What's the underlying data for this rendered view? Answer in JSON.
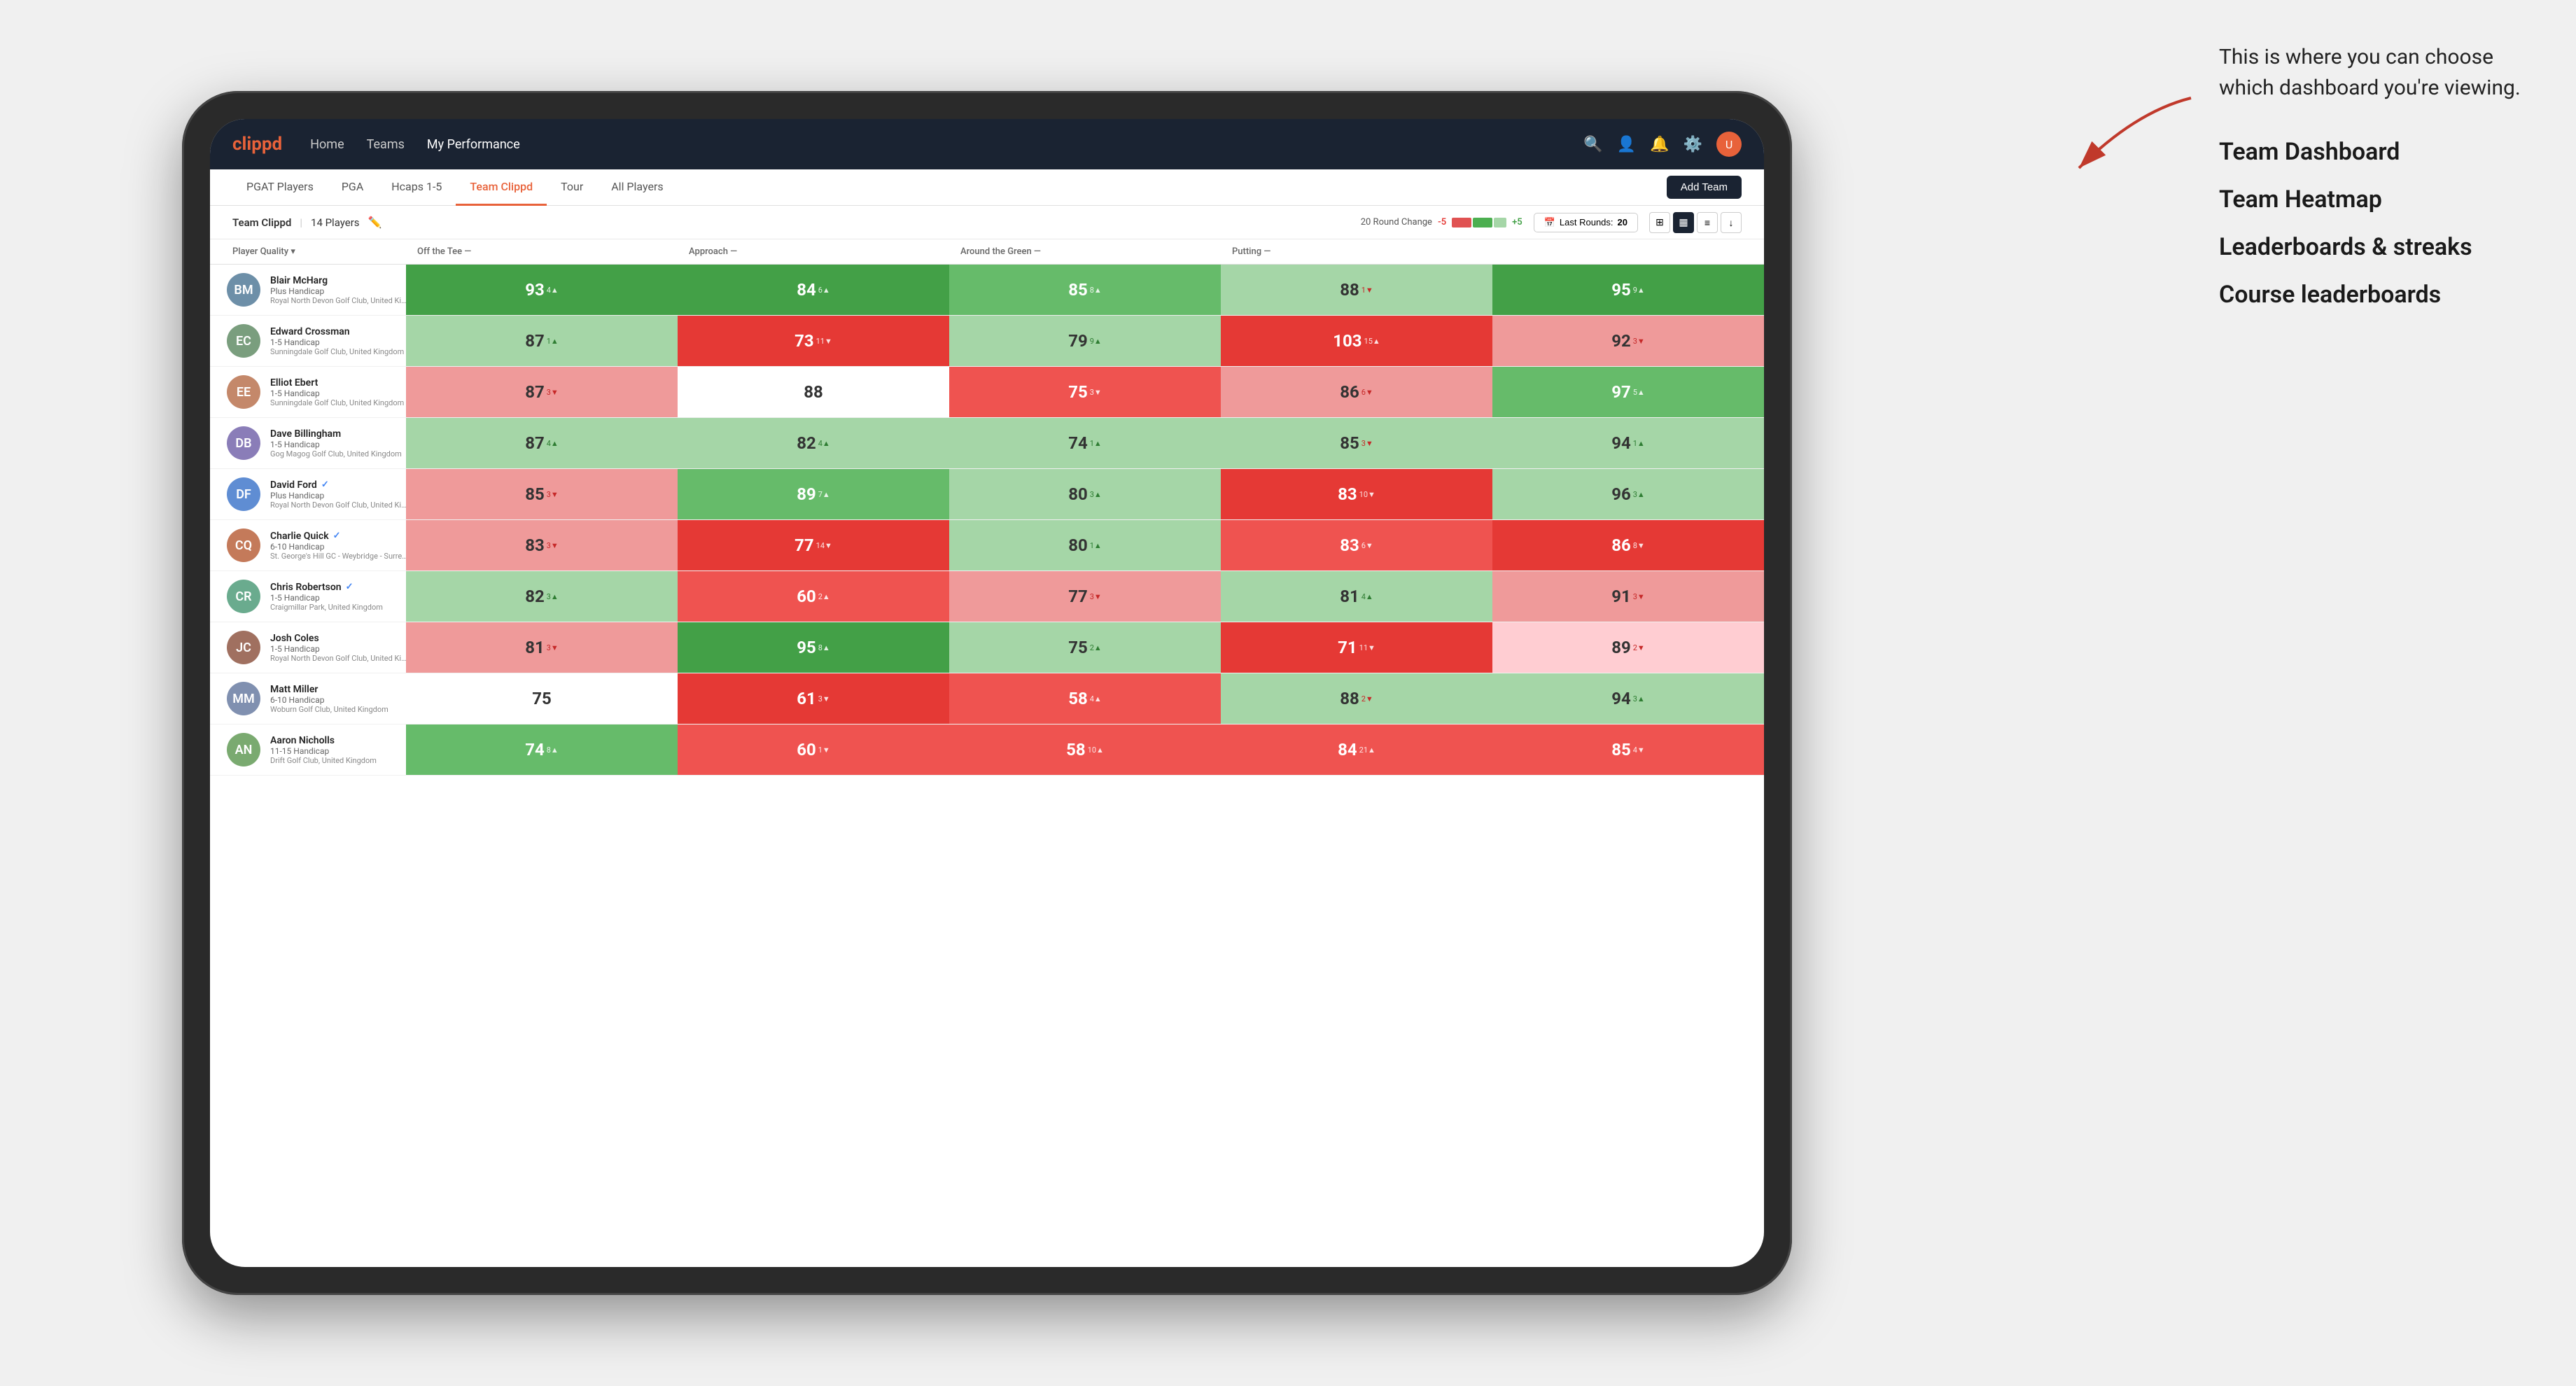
{
  "annotation": {
    "callout": "This is where you can choose which dashboard you're viewing.",
    "items": [
      "Team Dashboard",
      "Team Heatmap",
      "Leaderboards & streaks",
      "Course leaderboards"
    ]
  },
  "nav": {
    "logo": "clippd",
    "links": [
      "Home",
      "Teams",
      "My Performance"
    ],
    "active_link": "My Performance",
    "icons": [
      "search",
      "user",
      "bell",
      "settings",
      "avatar"
    ]
  },
  "sub_nav": {
    "tabs": [
      "PGAT Players",
      "PGA",
      "Hcaps 1-5",
      "Team Clippd",
      "Tour",
      "All Players"
    ],
    "active_tab": "Team Clippd",
    "add_team_label": "Add Team"
  },
  "team_bar": {
    "team_name": "Team Clippd",
    "player_count": "14 Players",
    "round_change_label": "20 Round Change",
    "change_minus": "-5",
    "change_plus": "+5",
    "last_rounds_label": "Last Rounds:",
    "last_rounds_value": "20"
  },
  "table": {
    "headers": [
      "Player Quality ▾",
      "Off the Tee —",
      "Approach —",
      "Around the Green —",
      "Putting —"
    ],
    "rows": [
      {
        "name": "Blair McHarg",
        "handicap": "Plus Handicap",
        "club": "Royal North Devon Golf Club, United Kingdom",
        "verified": false,
        "stats": [
          {
            "value": "93",
            "trend": "4▲",
            "bg": "bg-green-dark"
          },
          {
            "value": "84",
            "trend": "6▲",
            "bg": "bg-green-dark"
          },
          {
            "value": "85",
            "trend": "8▲",
            "bg": "bg-green-mid"
          },
          {
            "value": "88",
            "trend": "1▼",
            "bg": "bg-green-light"
          },
          {
            "value": "95",
            "trend": "9▲",
            "bg": "bg-green-dark"
          }
        ]
      },
      {
        "name": "Edward Crossman",
        "handicap": "1-5 Handicap",
        "club": "Sunningdale Golf Club, United Kingdom",
        "verified": false,
        "stats": [
          {
            "value": "87",
            "trend": "1▲",
            "bg": "bg-green-light"
          },
          {
            "value": "73",
            "trend": "11▼",
            "bg": "bg-red-dark"
          },
          {
            "value": "79",
            "trend": "9▲",
            "bg": "bg-green-light"
          },
          {
            "value": "103",
            "trend": "15▲",
            "bg": "bg-red-dark"
          },
          {
            "value": "92",
            "trend": "3▼",
            "bg": "bg-red-light"
          }
        ]
      },
      {
        "name": "Elliot Ebert",
        "handicap": "1-5 Handicap",
        "club": "Sunningdale Golf Club, United Kingdom",
        "verified": false,
        "stats": [
          {
            "value": "87",
            "trend": "3▼",
            "bg": "bg-red-light"
          },
          {
            "value": "88",
            "trend": "",
            "bg": "bg-white"
          },
          {
            "value": "75",
            "trend": "3▼",
            "bg": "bg-red-mid"
          },
          {
            "value": "86",
            "trend": "6▼",
            "bg": "bg-red-light"
          },
          {
            "value": "97",
            "trend": "5▲",
            "bg": "bg-green-mid"
          }
        ]
      },
      {
        "name": "Dave Billingham",
        "handicap": "1-5 Handicap",
        "club": "Gog Magog Golf Club, United Kingdom",
        "verified": false,
        "stats": [
          {
            "value": "87",
            "trend": "4▲",
            "bg": "bg-green-light"
          },
          {
            "value": "82",
            "trend": "4▲",
            "bg": "bg-green-light"
          },
          {
            "value": "74",
            "trend": "1▲",
            "bg": "bg-green-light"
          },
          {
            "value": "85",
            "trend": "3▼",
            "bg": "bg-green-light"
          },
          {
            "value": "94",
            "trend": "1▲",
            "bg": "bg-green-light"
          }
        ]
      },
      {
        "name": "David Ford",
        "handicap": "Plus Handicap",
        "club": "Royal North Devon Golf Club, United Kingdom",
        "verified": true,
        "stats": [
          {
            "value": "85",
            "trend": "3▼",
            "bg": "bg-red-light"
          },
          {
            "value": "89",
            "trend": "7▲",
            "bg": "bg-green-mid"
          },
          {
            "value": "80",
            "trend": "3▲",
            "bg": "bg-green-light"
          },
          {
            "value": "83",
            "trend": "10▼",
            "bg": "bg-red-dark"
          },
          {
            "value": "96",
            "trend": "3▲",
            "bg": "bg-green-light"
          }
        ]
      },
      {
        "name": "Charlie Quick",
        "handicap": "6-10 Handicap",
        "club": "St. George's Hill GC - Weybridge - Surrey, Uni...",
        "verified": true,
        "stats": [
          {
            "value": "83",
            "trend": "3▼",
            "bg": "bg-red-light"
          },
          {
            "value": "77",
            "trend": "14▼",
            "bg": "bg-red-dark"
          },
          {
            "value": "80",
            "trend": "1▲",
            "bg": "bg-green-light"
          },
          {
            "value": "83",
            "trend": "6▼",
            "bg": "bg-red-mid"
          },
          {
            "value": "86",
            "trend": "8▼",
            "bg": "bg-red-dark"
          }
        ]
      },
      {
        "name": "Chris Robertson",
        "handicap": "1-5 Handicap",
        "club": "Craigmillar Park, United Kingdom",
        "verified": true,
        "stats": [
          {
            "value": "82",
            "trend": "3▲",
            "bg": "bg-green-light"
          },
          {
            "value": "60",
            "trend": "2▲",
            "bg": "bg-red-mid"
          },
          {
            "value": "77",
            "trend": "3▼",
            "bg": "bg-red-light"
          },
          {
            "value": "81",
            "trend": "4▲",
            "bg": "bg-green-light"
          },
          {
            "value": "91",
            "trend": "3▼",
            "bg": "bg-red-light"
          }
        ]
      },
      {
        "name": "Josh Coles",
        "handicap": "1-5 Handicap",
        "club": "Royal North Devon Golf Club, United Kingdom",
        "verified": false,
        "stats": [
          {
            "value": "81",
            "trend": "3▼",
            "bg": "bg-red-light"
          },
          {
            "value": "95",
            "trend": "8▲",
            "bg": "bg-green-dark"
          },
          {
            "value": "75",
            "trend": "2▲",
            "bg": "bg-green-light"
          },
          {
            "value": "71",
            "trend": "11▼",
            "bg": "bg-red-dark"
          },
          {
            "value": "89",
            "trend": "2▼",
            "bg": "bg-pink-light"
          }
        ]
      },
      {
        "name": "Matt Miller",
        "handicap": "6-10 Handicap",
        "club": "Woburn Golf Club, United Kingdom",
        "verified": false,
        "stats": [
          {
            "value": "75",
            "trend": "",
            "bg": "bg-white"
          },
          {
            "value": "61",
            "trend": "3▼",
            "bg": "bg-red-dark"
          },
          {
            "value": "58",
            "trend": "4▲",
            "bg": "bg-red-mid"
          },
          {
            "value": "88",
            "trend": "2▼",
            "bg": "bg-green-light"
          },
          {
            "value": "94",
            "trend": "3▲",
            "bg": "bg-green-light"
          }
        ]
      },
      {
        "name": "Aaron Nicholls",
        "handicap": "11-15 Handicap",
        "club": "Drift Golf Club, United Kingdom",
        "verified": false,
        "stats": [
          {
            "value": "74",
            "trend": "8▲",
            "bg": "bg-green-mid"
          },
          {
            "value": "60",
            "trend": "1▼",
            "bg": "bg-red-mid"
          },
          {
            "value": "58",
            "trend": "10▲",
            "bg": "bg-red-mid"
          },
          {
            "value": "84",
            "trend": "21▲",
            "bg": "bg-red-mid"
          },
          {
            "value": "85",
            "trend": "4▼",
            "bg": "bg-red-mid"
          }
        ]
      }
    ]
  }
}
